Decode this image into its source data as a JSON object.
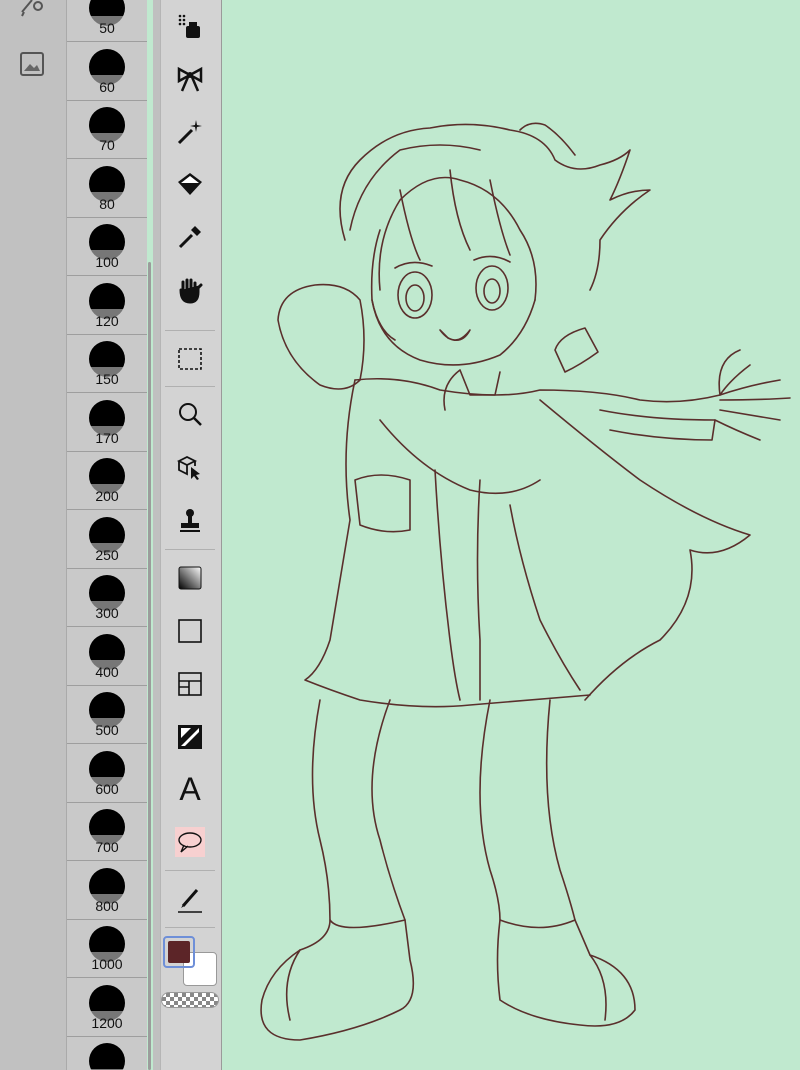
{
  "app": {
    "left_strip": {
      "icons": [
        "pen-settings-icon",
        "layer-image-icon"
      ]
    },
    "brush_sizes": [
      "50",
      "60",
      "70",
      "80",
      "100",
      "120",
      "150",
      "170",
      "200",
      "250",
      "300",
      "400",
      "500",
      "600",
      "700",
      "800",
      "1000",
      "1200"
    ],
    "toolbar": {
      "tools": [
        "spray-icon",
        "ribbon-icon",
        "magic-wand-icon",
        "fill-bucket-icon",
        "eyedropper-icon",
        "hand-icon",
        "selection-icon",
        "zoom-icon",
        "transform-icon",
        "stamp-icon",
        "gradient-icon",
        "rectangle-icon",
        "frame-icon",
        "tone-icon",
        "text-icon",
        "speech-balloon-icon",
        "line-pen-icon"
      ],
      "text_tool_glyph": "A"
    },
    "colors": {
      "main_color": "#5c2528",
      "sub_color": "#ffffff",
      "canvas_background": "#c0e9cf",
      "line_color": "#5a2f2c"
    }
  }
}
